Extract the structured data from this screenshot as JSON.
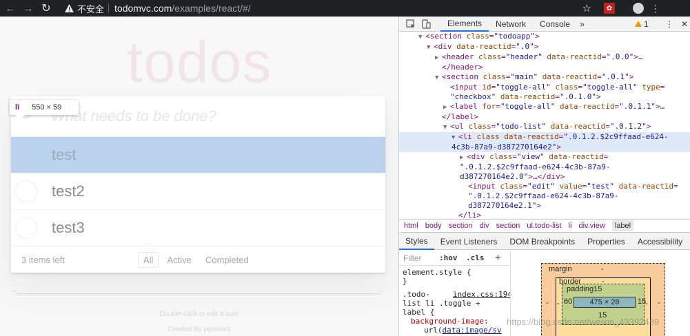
{
  "browser": {
    "not_secure": "不安全",
    "url_host": "todomvc.com",
    "url_path": "/examples/react/#/"
  },
  "app": {
    "title": "todos",
    "new_todo_placeholder": "What needs to be done?",
    "todos": [
      {
        "label": "test",
        "highlighted": true
      },
      {
        "label": "test2",
        "highlighted": false
      },
      {
        "label": "test3",
        "highlighted": false
      }
    ],
    "count_text": "3 items left",
    "filters": [
      {
        "label": "All",
        "selected": true
      },
      {
        "label": "Active",
        "selected": false
      },
      {
        "label": "Completed",
        "selected": false
      }
    ],
    "info_line1": "Double-click to edit a todo",
    "info_created_by": "Created by",
    "info_author": "petehunt"
  },
  "tooltip": {
    "tag": "li",
    "dims": "550 × 59"
  },
  "devtools": {
    "tabs": [
      "Elements",
      "Network",
      "Console"
    ],
    "active_tab": "Elements",
    "more": "»",
    "warnings": "1",
    "kebab": "⋮",
    "close": "✕",
    "breadcrumbs": [
      "html",
      "body",
      "section",
      "div",
      "section",
      "ul.todo-list",
      "li",
      "div.view",
      "label"
    ],
    "selected_breadcrumb": "label",
    "sub_tabs": [
      "Styles",
      "Event Listeners",
      "DOM Breakpoints",
      "Properties",
      "Accessibility"
    ],
    "active_sub_tab": "Styles",
    "filter_placeholder": "Filter",
    "hov": ":hov",
    "cls": ".cls",
    "plus": "+",
    "styles": {
      "element_style": "element.style {",
      "element_close": "}",
      "rule_selector_1": ".todo-",
      "rule_source": "index.css:194",
      "rule_selector_2": "list li .toggle +",
      "rule_selector_3": "label {",
      "prop_name": "background-image:",
      "prop_value_prefix": "url(",
      "prop_value_link": "data:image/sv"
    },
    "box_model": {
      "margin_label": "margin",
      "margin_value": "-",
      "border_label": "border",
      "border_value": "-",
      "padding_label": "padding15",
      "content": "475 × 28",
      "padding_left": "60",
      "padding_right": "15",
      "padding_bottom": "15",
      "side_dash": "-"
    }
  },
  "watermark": "https://blog.csdn.net/weixin_43392489"
}
